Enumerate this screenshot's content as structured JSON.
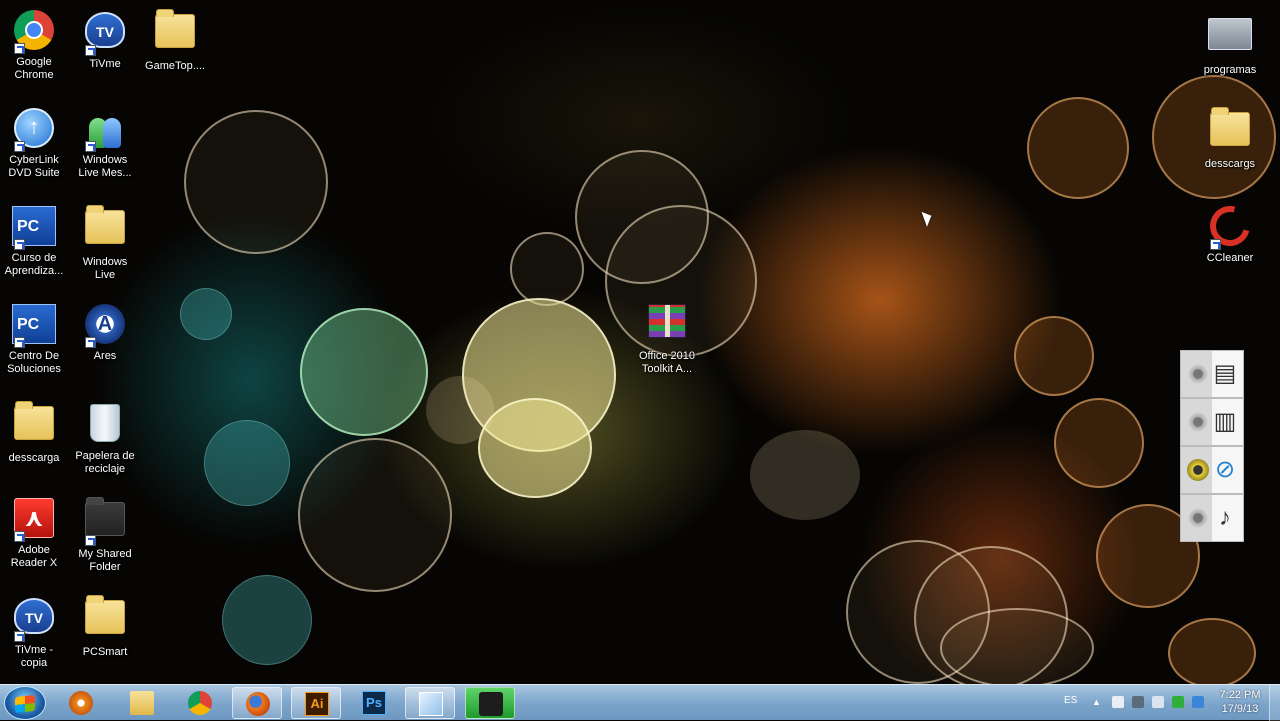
{
  "desktop": {
    "icons_left": [
      {
        "label": "Google\nChrome",
        "icon": "chrome-icon"
      },
      {
        "label": "TiVme",
        "icon": "tivme-icon"
      },
      {
        "label": "GameTop....",
        "icon": "folder-icon"
      },
      {
        "label": "CyberLink\nDVD Suite",
        "icon": "cyberlink-icon"
      },
      {
        "label": "Windows\nLive Mes...",
        "icon": "messenger-icon"
      },
      {
        "label": "Curso de\nAprendiza...",
        "icon": "pcsmart-icon"
      },
      {
        "label": "Windows\nLive",
        "icon": "folder-icon"
      },
      {
        "label": "Centro De\nSoluciones",
        "icon": "pcsmart-icon"
      },
      {
        "label": "Ares",
        "icon": "ares-icon"
      },
      {
        "label": "desscarga",
        "icon": "folder-icon"
      },
      {
        "label": "Papelera de\nreciclaje",
        "icon": "recycle-bin-icon"
      },
      {
        "label": "Adobe\nReader X",
        "icon": "adobe-reader-icon"
      },
      {
        "label": "My Shared\nFolder",
        "icon": "folder-icon"
      },
      {
        "label": "TiVme -\ncopia",
        "icon": "tivme-icon"
      },
      {
        "label": "PCSmart",
        "icon": "folder-icon"
      }
    ],
    "icons_right": [
      {
        "label": "programas",
        "icon": "programs-icon"
      },
      {
        "label": "desscargs",
        "icon": "folder-icon"
      },
      {
        "label": "CCleaner",
        "icon": "ccleaner-icon"
      }
    ],
    "icon_center": {
      "label": "Office 2010\nToolkit A...",
      "icon": "winrar-archive-icon"
    },
    "widget": {
      "name": "gadget-cubes",
      "symbols": [
        "document-icon",
        "folder-stack-icon",
        "network-icon",
        "music-note-icon"
      ]
    }
  },
  "taskbar": {
    "buttons": [
      {
        "name": "start-button"
      },
      {
        "name": "media-player-icon"
      },
      {
        "name": "explorer-icon"
      },
      {
        "name": "chrome-icon"
      },
      {
        "name": "firefox-icon"
      },
      {
        "name": "illustrator-icon",
        "text": "Ai"
      },
      {
        "name": "photoshop-icon",
        "text": "Ps"
      },
      {
        "name": "window-icon"
      },
      {
        "name": "camera-icon"
      }
    ],
    "tray": {
      "language": "ES",
      "clock_time": "7:22 PM",
      "clock_date": "17/9/13"
    }
  },
  "colors": {
    "taskbar_top": "#a9c6e0",
    "taskbar_bottom": "#6d97c0",
    "label_text": "#ffffff"
  }
}
